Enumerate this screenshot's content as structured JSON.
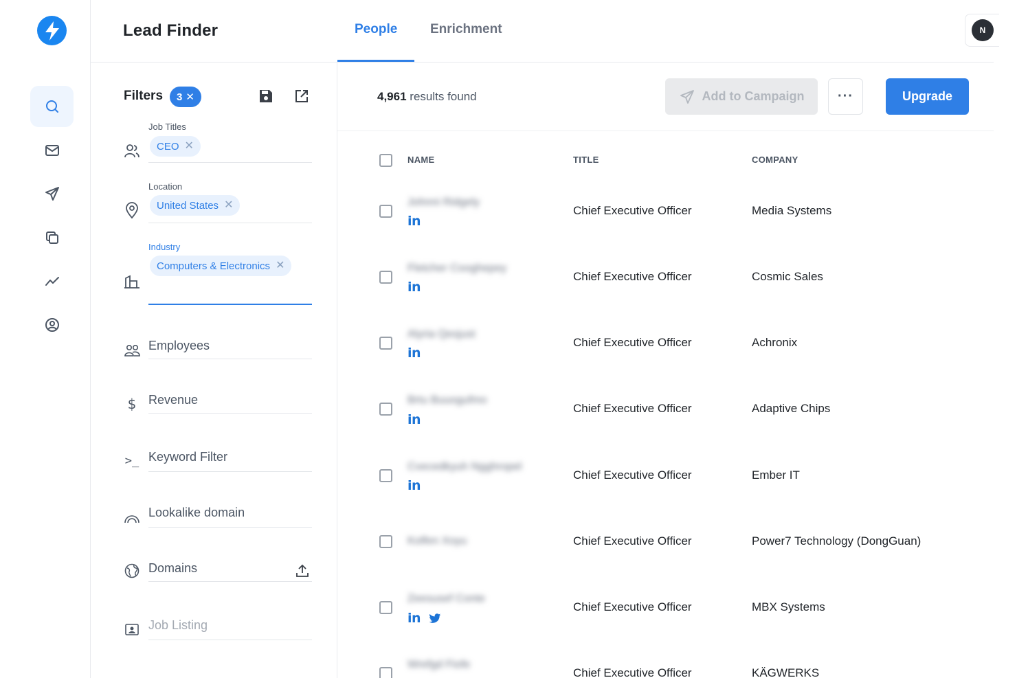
{
  "app": {
    "title": "Lead Finder",
    "avatar_initial": "N"
  },
  "tabs": [
    {
      "label": "People",
      "active": true
    },
    {
      "label": "Enrichment",
      "active": false
    }
  ],
  "rail": [
    "search-icon",
    "mail-icon",
    "send-icon",
    "copy-icon",
    "trend-icon",
    "profile-icon"
  ],
  "filters": {
    "title": "Filters",
    "count": "3",
    "job_titles": {
      "label": "Job Titles",
      "chip": "CEO"
    },
    "location": {
      "label": "Location",
      "chip": "United States"
    },
    "industry": {
      "label": "Industry",
      "chip": "Computers & Electronics"
    },
    "more": [
      {
        "label": "Employees"
      },
      {
        "label": "Revenue"
      },
      {
        "label": "Keyword Filter"
      },
      {
        "label": "Lookalike domain"
      },
      {
        "label": "Domains"
      },
      {
        "label": "Job Listing"
      }
    ]
  },
  "results": {
    "count": "4,961",
    "suffix": "results found",
    "add_to_campaign": "Add to Campaign",
    "more": "···",
    "upgrade": "Upgrade"
  },
  "table": {
    "headers": {
      "name": "NAME",
      "title": "TITLE",
      "company": "COMPANY"
    },
    "rows": [
      {
        "name": "Johnni Ridgely",
        "title": "Chief Executive Officer",
        "company": "Media Systems",
        "twitter": false
      },
      {
        "name": "Fletcher Cooghepey",
        "title": "Chief Executive Officer",
        "company": "Cosmic Sales",
        "twitter": false
      },
      {
        "name": "Alyria Qesjust",
        "title": "Chief Executive Officer",
        "company": "Achronix",
        "twitter": false
      },
      {
        "name": "Brtu Buuogufmo",
        "title": "Chief Executive Officer",
        "company": "Adaptive Chips",
        "twitter": false
      },
      {
        "name": "Cvecedkyuh Ngghropel",
        "title": "Chief Executive Officer",
        "company": "Ember IT",
        "twitter": false
      },
      {
        "name": "Kolfen Xoyu",
        "title": "Chief Executive Officer",
        "company": "Power7 Technology (DongGuan)",
        "twitter": false
      },
      {
        "name": "Zeesusef Conte",
        "title": "Chief Executive Officer",
        "company": "MBX Systems",
        "twitter": true
      },
      {
        "name": "Wrefgd Fiofe",
        "title": "Chief Executive Officer",
        "company": "KÄGWERKS",
        "twitter": false
      }
    ]
  }
}
